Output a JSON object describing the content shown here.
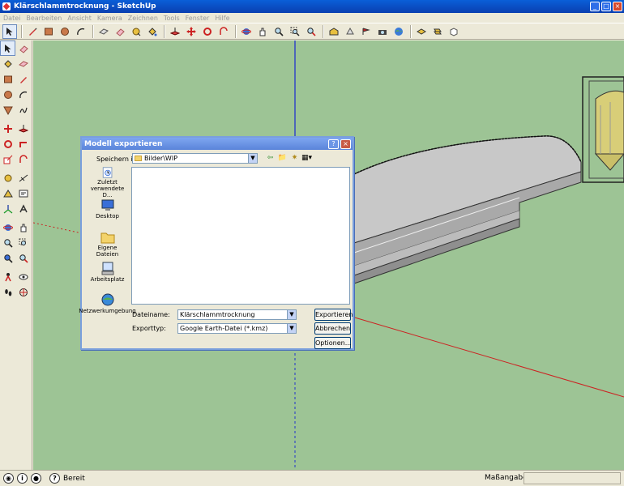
{
  "window": {
    "title": "Klärschlammtrocknung - SketchUp"
  },
  "menu": [
    "Datei",
    "Bearbeiten",
    "Ansicht",
    "Kamera",
    "Zeichnen",
    "Tools",
    "Fenster",
    "Hilfe"
  ],
  "status": {
    "help_glyph": "?",
    "text": "Bereit",
    "measure_label": "Maßangaben"
  },
  "dialog": {
    "title": "Modell exportieren",
    "help_glyph": "?",
    "close_glyph": "×",
    "look_in_label": "Speichern in:",
    "look_in_value": "Bilder\\WIP",
    "places": [
      {
        "label": "Zuletzt verwendete D..."
      },
      {
        "label": "Desktop"
      },
      {
        "label": "Eigene Dateien"
      },
      {
        "label": "Arbeitsplatz"
      },
      {
        "label": "Netzwerkumgebung"
      }
    ],
    "filename_label": "Dateiname:",
    "filename_value": "Klärschlammtrocknung",
    "filetype_label": "Exporttyp:",
    "filetype_value": "Google Earth-Datei (*.kmz)",
    "export_button": "Exportieren",
    "cancel_button": "Abbrechen",
    "options_button": "Optionen..."
  },
  "colors": {
    "ground": "#9dc495",
    "title_bar": "#0a5fd8",
    "dialog_title": "#6d96e6"
  }
}
